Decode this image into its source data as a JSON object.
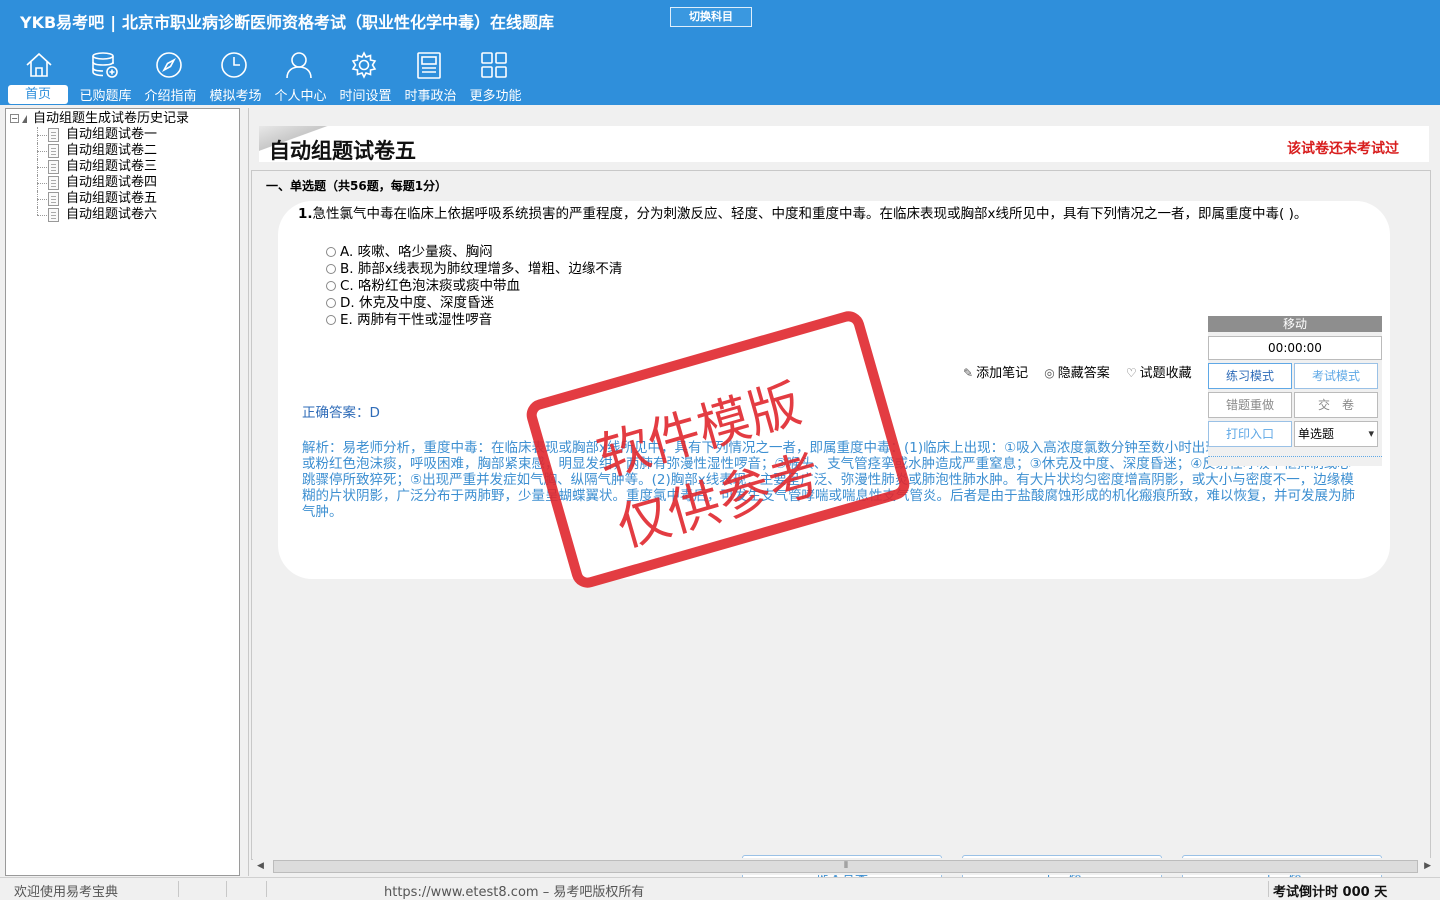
{
  "header": {
    "brand": "YKB易考吧",
    "title": "北京市职业病诊断医师资格考试（职业性化学中毒）在线题库",
    "switch_label": "切换科目",
    "nav": [
      {
        "label": "首页",
        "icon": "home-icon"
      },
      {
        "label": "已购题库",
        "icon": "database-icon"
      },
      {
        "label": "介绍指南",
        "icon": "compass-icon"
      },
      {
        "label": "模拟考场",
        "icon": "clock-icon"
      },
      {
        "label": "个人中心",
        "icon": "user-icon"
      },
      {
        "label": "时间设置",
        "icon": "gear-icon"
      },
      {
        "label": "时事政治",
        "icon": "news-icon"
      },
      {
        "label": "更多功能",
        "icon": "grid-icon"
      }
    ]
  },
  "tree": {
    "root": "自动组题生成试卷历史记录",
    "items": [
      "自动组题试卷一",
      "自动组题试卷二",
      "自动组题试卷三",
      "自动组题试卷四",
      "自动组题试卷五",
      "自动组题试卷六"
    ]
  },
  "paper": {
    "title": "自动组题试卷五",
    "status": "该试卷还未考试过",
    "section": "一、单选题（共56题，每题1分）"
  },
  "question": {
    "number": "1.",
    "text": "急性氯气中毒在临床上依据呼吸系统损害的严重程度，分为刺激反应、轻度、中度和重度中毒。在临床表现或胸部x线所见中，具有下列情况之一者，即属重度中毒( )。",
    "options": [
      "A. 咳嗽、咯少量痰、胸闷",
      "B. 肺部x线表现为肺纹理增多、增粗、边缘不清",
      "C. 咯粉红色泡沫痰或痰中带血",
      "D. 休克及中度、深度昏迷",
      "E. 两肺有干性或湿性啰音"
    ],
    "actions": {
      "note": "添加笔记",
      "hide": "隐藏答案",
      "fav": "试题收藏"
    },
    "answer": "正确答案：D",
    "analysis": "解析：易老师分析，重度中毒：在临床表现或胸部x线所见中，具有下列情况之一者，即属重度中毒：(1)临床上出现：①吸入高浓度氯数分钟至数小时出现肺水肿，可咯大量白色或粉红色泡沫痰，呼吸困难，胸部紧束感，明显发绀，两肺有弥漫性湿性啰音；②喉头、支气管痉挛或水肿造成严重窒息；③休克及中度、深度昏迷；④反射性呼吸中枢抑制或心跳骤停所致猝死；⑤出现严重并发症如气胸、纵隔气肿等。(2)胸部x线表现：主要呈广泛、弥漫性肺炎或肺泡性肺水肿。有大片状均匀密度增高阴影，或大小与密度不一，边缘模糊的片状阴影，广泛分布于两肺野，少量呈蝴蝶翼状。重度氯中毒后，可发生支气管哮喘或喘息性支气管炎。后者是由于盐酸腐蚀形成的机化瘢痕所致，难以恢复，并可发展为肺气肿。"
  },
  "widget": {
    "move": "移动",
    "timer": "00:00:00",
    "practice": "练习模式",
    "exam": "考试模式",
    "redo": "错题重做",
    "hand_in": "交　卷",
    "print": "打印入口",
    "type_select": "单选题"
  },
  "stamp": {
    "line1": "软件模版",
    "line2": "仅供参考"
  },
  "buttons": {
    "submit": "提交答案",
    "prev": "上一题",
    "next": "下一题"
  },
  "status": {
    "welcome": "欢迎使用易考宝典",
    "copyright": "https://www.etest8.com – 易考吧版权所有",
    "countdown": "考试倒计时 000 天"
  },
  "colors": {
    "header_bg": "#2f8fdb",
    "status_red": "#d81e1e",
    "analysis_blue": "#3d8fd1",
    "stamp_red": "#e0282e"
  }
}
